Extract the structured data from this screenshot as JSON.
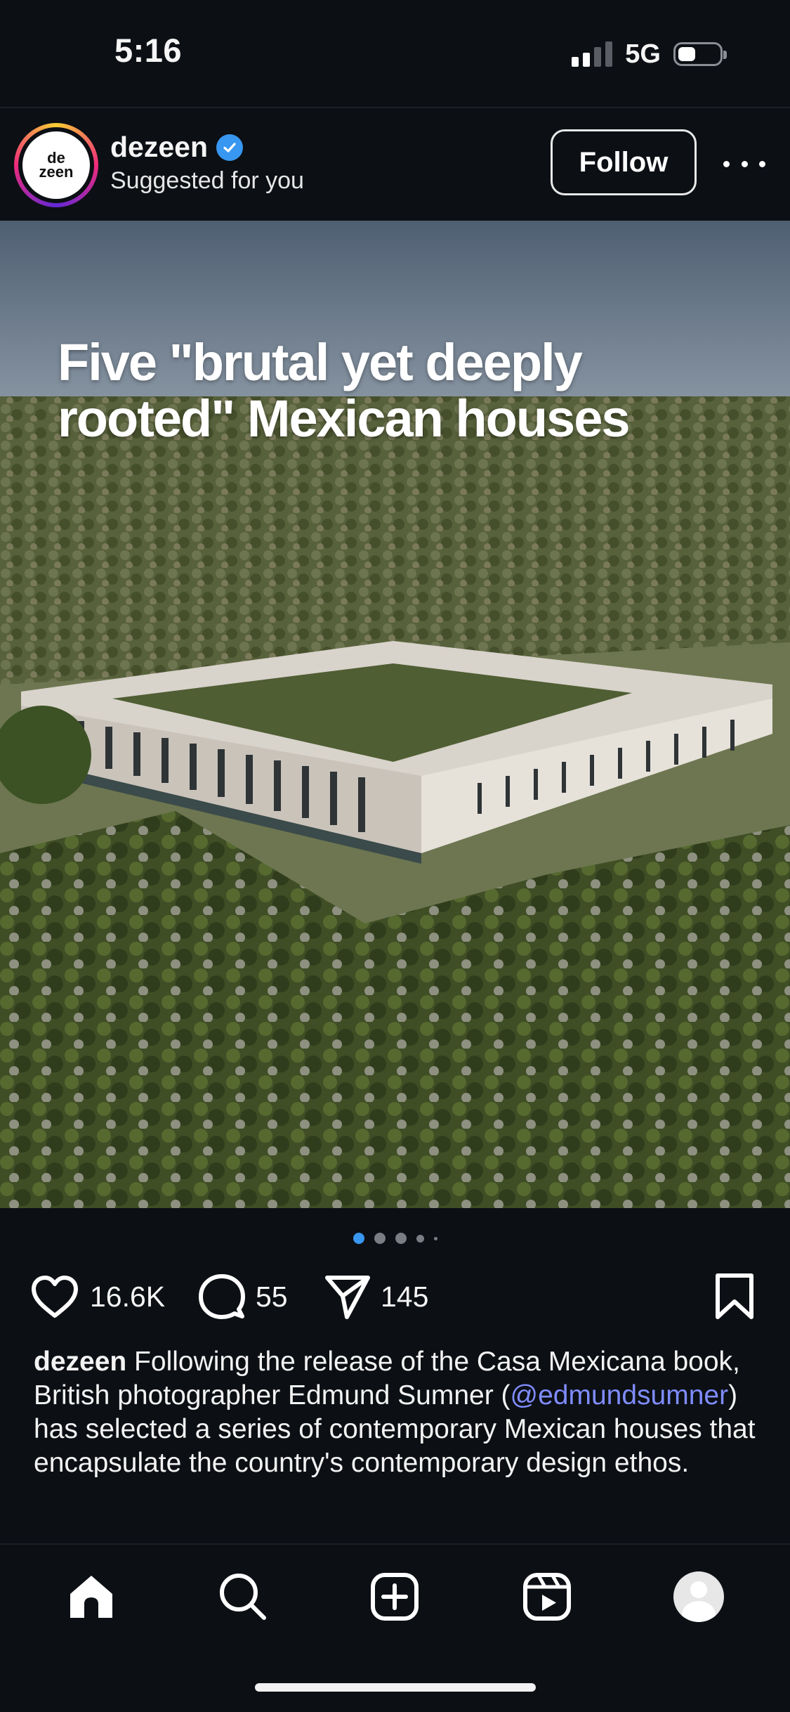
{
  "status_bar": {
    "time": "5:16",
    "network": "5G",
    "signal_bars_active": 2,
    "signal_bars_total": 4,
    "battery_level": 0.25
  },
  "post": {
    "username": "dezeen",
    "avatar_text": "dezeen",
    "subtitle": "Suggested for you",
    "follow_label": "Follow",
    "verified": true,
    "image_headline": "Five \"brutal yet deeply rooted\" Mexican houses",
    "carousel": {
      "count": 5,
      "active_index": 0,
      "active_color": "#3897f0"
    },
    "actions": {
      "likes": "16.6K",
      "comments": "55",
      "shares": "145"
    },
    "caption": {
      "user": "dezeen",
      "text_before": " Following the release of the Casa Mexicana book, British photographer Edmund Sumner (",
      "mention": "@edmundsumner",
      "text_after": ") has selected a series of contemporary Mexican houses that encapsulate the country's contemporary design ethos."
    }
  },
  "nav": {
    "items": [
      "home-icon",
      "search-icon",
      "create-icon",
      "reels-icon",
      "profile-avatar"
    ],
    "active": "home-icon"
  },
  "colors": {
    "background": "#0c0f14",
    "accent_blue": "#3897f0",
    "mention": "#7f8cff"
  }
}
